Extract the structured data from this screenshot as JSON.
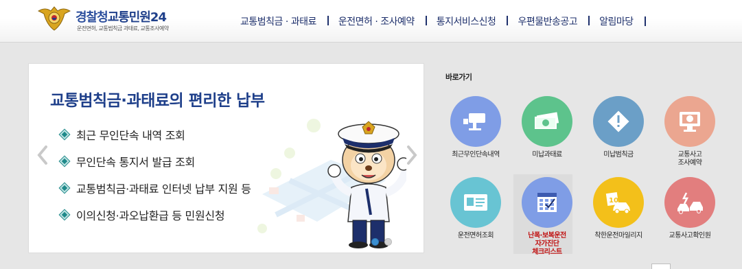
{
  "header": {
    "logo_title_main": "경찰청",
    "logo_title_accent": "교통민원24",
    "logo_subtitle": "운전면허, 교통범칙금 과태료, 교통조사예약",
    "nav": [
      {
        "label": "교통범칙금 · 과태료"
      },
      {
        "label": "운전면허 · 조사예약"
      },
      {
        "label": "통지서비스신청"
      },
      {
        "label": "우편물반송공고"
      },
      {
        "label": "알림마당"
      }
    ]
  },
  "slider": {
    "title": "교통범칙금·과태료의 편리한 납부",
    "items": [
      "최근 무인단속 내역 조회",
      "무인단속 통지서 발급 조회",
      "교통범칙금·과태료 인터넷 납부 지원 등",
      "이의신청·과오납환급 등 민원신청"
    ],
    "active_slide": 1,
    "slide_count": 2
  },
  "quick": {
    "title": "바로가기",
    "items": [
      {
        "label": "최근무인단속내역",
        "icon": "camera-icon",
        "color": "#7f9de6"
      },
      {
        "label": "미납과태료",
        "icon": "money-icon",
        "color": "#5dc38c"
      },
      {
        "label": "미납범칙금",
        "icon": "warning-icon",
        "color": "#6b9fc7"
      },
      {
        "label": "교통사고",
        "label2": "조사예약",
        "icon": "computer-icon",
        "color": "#eba690"
      },
      {
        "label": "운전면허조회",
        "icon": "license-card-icon",
        "color": "#68c4d3"
      },
      {
        "label": "난폭·보복운전",
        "label2": "자가진단",
        "label3": "체크리스트",
        "icon": "checklist-icon",
        "color": "#7f9de6",
        "red": true
      },
      {
        "label": "착한운전마일리지",
        "icon": "mileage-car-icon",
        "color": "#f3c01a"
      },
      {
        "label": "교통사고확인원",
        "icon": "car-crash-icon",
        "color": "#e27e7e"
      }
    ]
  }
}
